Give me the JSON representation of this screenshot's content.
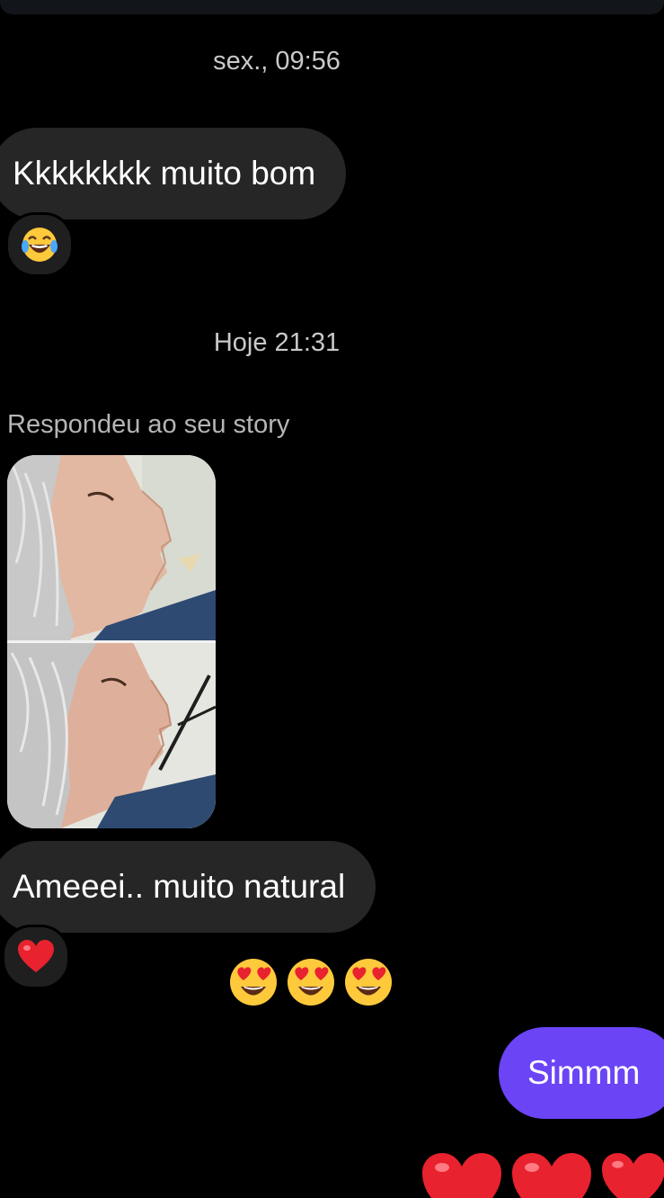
{
  "thread": {
    "timestamp_1": "sex., 09:56",
    "message_1": "Kkkkkkkk muito bom",
    "message_1_reaction": "laughing-tears-emoji",
    "timestamp_2": "Hoje 21:31",
    "story_reply_label": "Respondeu ao seu story",
    "story_preview": "before-after-profile-photo",
    "message_2": "Ameeei.. muito natural",
    "message_2_reaction": "red-heart-emoji",
    "emoji_message": [
      "heart-eyes-emoji",
      "heart-eyes-emoji",
      "heart-eyes-emoji"
    ],
    "outgoing_message": "Simmm",
    "hearts_message": [
      "red-heart-emoji",
      "red-heart-emoji",
      "red-heart-emoji"
    ]
  },
  "colors": {
    "background": "#000000",
    "incoming_bubble": "#262626",
    "outgoing_bubble": "#6b44f6",
    "timestamp_text": "#c9c9c9"
  }
}
